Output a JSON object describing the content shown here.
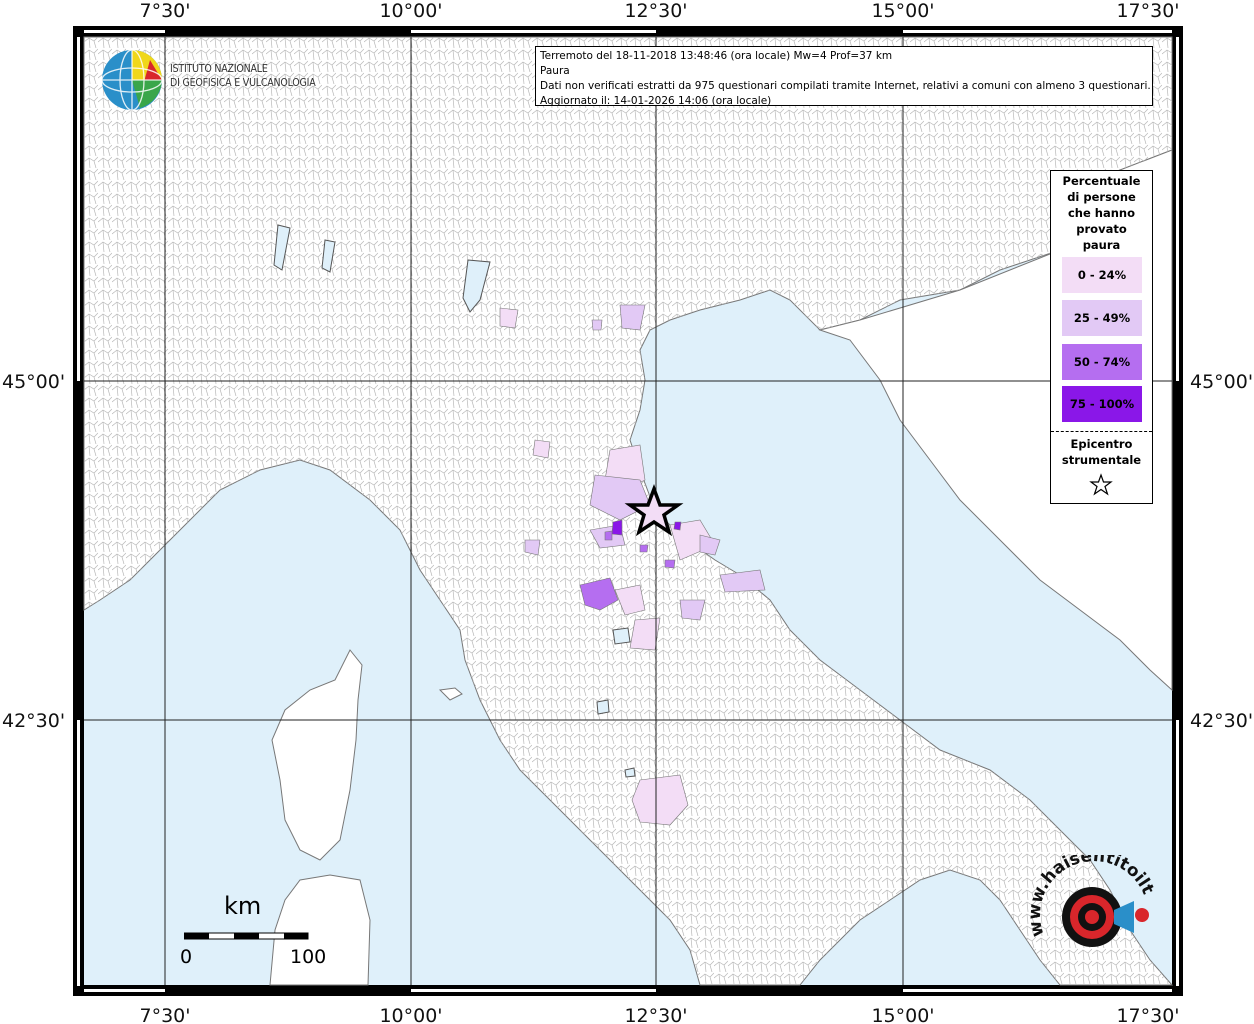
{
  "map": {
    "lon_ticks": [
      "7°30'",
      "10°00'",
      "12°30'",
      "15°00'",
      "17°30'"
    ],
    "lat_ticks": [
      "45°00'",
      "42°30'"
    ],
    "colors": {
      "sea": "#dff0fa",
      "land": "#ffffff",
      "border": "#888888",
      "grid": "#222222",
      "class_0_24": "#f3ddf6",
      "class_25_49": "#e2c9f5",
      "class_50_74": "#b56ef0",
      "class_75_100": "#8a17e8"
    }
  },
  "info_box": {
    "line1": "Terremoto del 18-11-2018 13:48:46 (ora locale) Mw=4 Prof=37 km",
    "line2": "Paura",
    "line3": "Dati non verificati estratti da 975 questionari compilati tramite Internet, relativi a comuni con almeno 3 questionari.",
    "line4": "Aggiornato il: 14-01-2026 14:06 (ora locale)"
  },
  "legend": {
    "title_lines": [
      "Percentuale",
      "di persone",
      "che hanno",
      "provato",
      "paura"
    ],
    "items": [
      {
        "label": "0 - 24%",
        "color": "#f3ddf6"
      },
      {
        "label": "25 - 49%",
        "color": "#e2c9f5"
      },
      {
        "label": "50 - 74%",
        "color": "#b56ef0"
      },
      {
        "label": "75 - 100%",
        "color": "#8a17e8"
      }
    ],
    "epicenter_lines": [
      "Epicentro",
      "strumentale"
    ],
    "epicenter_icon": "star-icon"
  },
  "logo": {
    "lines": [
      "ISTITUTO NAZIONALE",
      "DI GEOFISICA E VULCANOLOGIA"
    ],
    "icon": "globe-icon"
  },
  "scale_bar": {
    "unit": "km",
    "start": "0",
    "end": "100"
  },
  "watermark": {
    "text": "www.haisentitoilterremoto.it",
    "icon": "target-megaphone-icon"
  }
}
